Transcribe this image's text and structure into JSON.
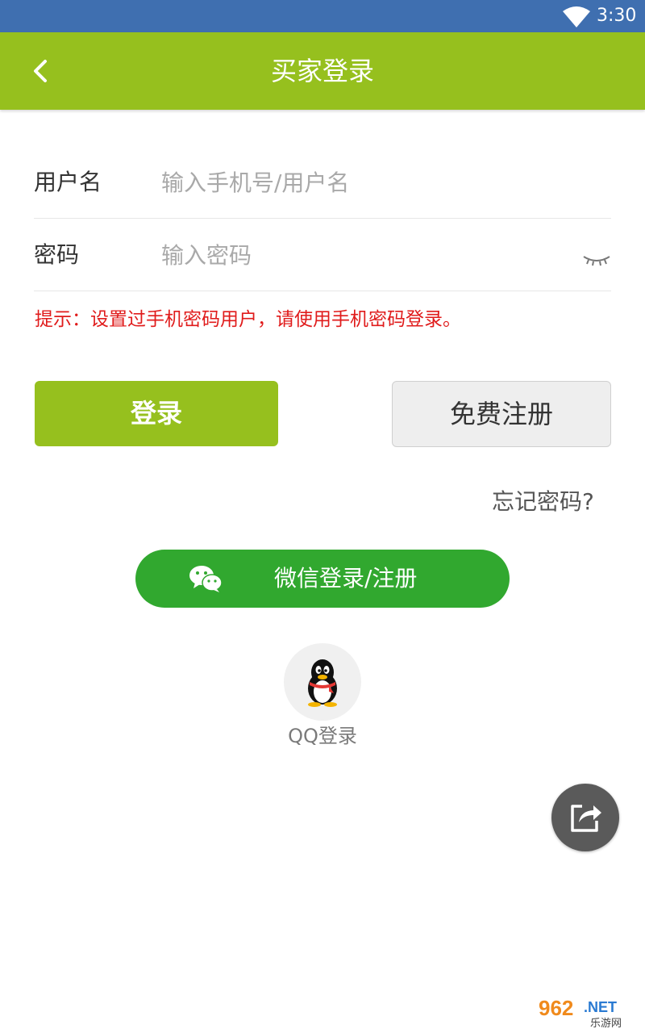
{
  "status_bar": {
    "time": "3:30"
  },
  "header": {
    "title": "买家登录"
  },
  "form": {
    "username_label": "用户名",
    "username_placeholder": "输入手机号/用户名",
    "password_label": "密码",
    "password_placeholder": "输入密码",
    "hint": "提示：设置过手机密码用户，请使用手机密码登录。"
  },
  "actions": {
    "login_label": "登录",
    "register_label": "免费注册",
    "forgot_label": "忘记密码?",
    "wechat_label": "微信登录/注册",
    "qq_label": "QQ登录"
  },
  "watermark": {
    "brand": "962.NET",
    "sub": "乐游网"
  },
  "colors": {
    "status_bar": "#3f6fb0",
    "brand_green": "#96c01e",
    "wechat_green": "#31a82f",
    "hint_red": "#e01b1b"
  },
  "icons": [
    "wifi-icon",
    "back-arrow-icon",
    "eye-closed-icon",
    "wechat-icon",
    "qq-penguin-icon",
    "share-icon"
  ]
}
